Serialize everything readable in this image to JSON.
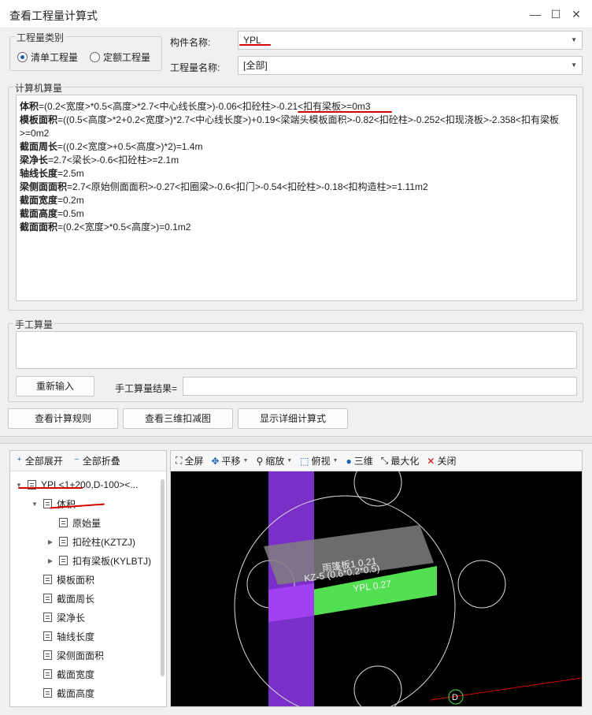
{
  "window": {
    "title": "查看工程量计算式",
    "minimize": "—",
    "maximize": "☐",
    "close": "✕"
  },
  "category": {
    "legend": "工程量类别",
    "options": [
      {
        "label": "清单工程量",
        "selected": true
      },
      {
        "label": "定额工程量",
        "selected": false
      }
    ]
  },
  "component": {
    "label": "构件名称:",
    "value": "YPL"
  },
  "quantity": {
    "label": "工程量名称:",
    "value": "[全部]"
  },
  "computer": {
    "legend": "计算机算量",
    "lines": [
      {
        "name": "体积",
        "expr": "=(0.2<宽度>*0.5<高度>*2.7<中心线长度>)-0.06<扣砼柱>-0.21<扣有梁板>=0m3"
      },
      {
        "name": "模板面积",
        "expr": "=((0.5<高度>*2+0.2<宽度>)*2.7<中心线长度>)+0.19<梁端头模板面积>-0.82<扣砼柱>-0.252<扣现浇板>-2.358<扣有梁板>=0m2"
      },
      {
        "name": "截面周长",
        "expr": "=((0.2<宽度>+0.5<高度>)*2)=1.4m"
      },
      {
        "name": "梁净长",
        "expr": "=2.7<梁长>-0.6<扣砼柱>=2.1m"
      },
      {
        "name": "轴线长度",
        "expr": "=2.5m"
      },
      {
        "name": "梁侧面面积",
        "expr": "=2.7<原始侧面面积>-0.27<扣圈梁>-0.6<扣门>-0.54<扣砼柱>-0.18<扣构造柱>=1.11m2"
      },
      {
        "name": "截面宽度",
        "expr": "=0.2m"
      },
      {
        "name": "截面高度",
        "expr": "=0.5m"
      },
      {
        "name": "截面面积",
        "expr": "=(0.2<宽度>*0.5<高度>)=0.1m2"
      }
    ]
  },
  "manual": {
    "legend": "手工算量",
    "reenter": "重新输入",
    "result_label": "手工算量结果=",
    "result_value": ""
  },
  "actions": {
    "rules": "查看计算规则",
    "view3d": "查看三维扣减图",
    "detail": "显示详细计算式"
  },
  "tree": {
    "expand_all": "全部展开",
    "collapse_all": "全部折叠",
    "nodes": [
      {
        "label": "YPL<1+200,D-100><...",
        "level": 0,
        "toggle": "▼"
      },
      {
        "label": "体积",
        "level": 1,
        "toggle": "▼"
      },
      {
        "label": "原始量",
        "level": 2,
        "toggle": ""
      },
      {
        "label": "扣砼柱(KZTZJ)",
        "level": 2,
        "toggle": "▶"
      },
      {
        "label": "扣有梁板(KYLBTJ)",
        "level": 2,
        "toggle": "▶"
      },
      {
        "label": "模板面积",
        "level": 1,
        "toggle": ""
      },
      {
        "label": "截面周长",
        "level": 1,
        "toggle": ""
      },
      {
        "label": "梁净长",
        "level": 1,
        "toggle": ""
      },
      {
        "label": "轴线长度",
        "level": 1,
        "toggle": ""
      },
      {
        "label": "梁侧面面积",
        "level": 1,
        "toggle": ""
      },
      {
        "label": "截面宽度",
        "level": 1,
        "toggle": ""
      },
      {
        "label": "截面高度",
        "level": 1,
        "toggle": ""
      }
    ]
  },
  "viewer": {
    "tools": {
      "fullscreen": "全屏",
      "pan": "平移",
      "zoom": "缩放",
      "top": "俯视",
      "threed": "三维",
      "maximize": "最大化",
      "close": "关闭"
    },
    "labels": {
      "slab": "雨篷板1 0.21",
      "column": "KZ-5 (0.6*0.2*0.5)",
      "beam": "YPL 0.27",
      "axis": "D"
    }
  },
  "colors": {
    "accent": "#1a5fb4",
    "annotation": "#d40000",
    "column": "#8a2be2",
    "beam": "#52e052",
    "slab": "#7f7f7f"
  }
}
